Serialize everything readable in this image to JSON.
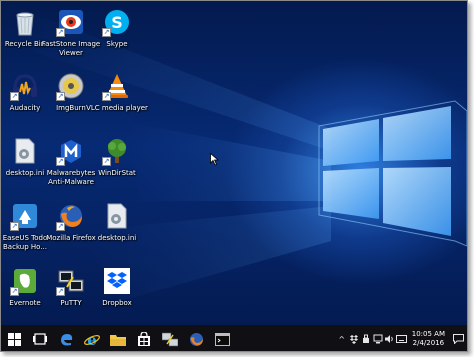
{
  "desktop": {
    "icons": [
      {
        "label": "Recycle Bin",
        "icon": "recycle-bin-icon"
      },
      {
        "label": "FastStone Image Viewer",
        "icon": "faststone-icon"
      },
      {
        "label": "Skype",
        "icon": "skype-icon"
      },
      {
        "label": "Audacity",
        "icon": "audacity-icon"
      },
      {
        "label": "ImgBurn",
        "icon": "imgburn-icon"
      },
      {
        "label": "VLC media player",
        "icon": "vlc-icon"
      },
      {
        "label": "desktop.ini",
        "icon": "ini-file-icon"
      },
      {
        "label": "Malwarebytes Anti-Malware",
        "icon": "malwarebytes-icon"
      },
      {
        "label": "WinDirStat",
        "icon": "windirstat-icon"
      },
      {
        "label": "EaseUS Todo Backup Ho...",
        "icon": "easeus-icon"
      },
      {
        "label": "Mozilla Firefox",
        "icon": "firefox-icon"
      },
      {
        "label": "desktop.ini",
        "icon": "ini-file-icon"
      },
      {
        "label": "Evernote",
        "icon": "evernote-icon"
      },
      {
        "label": "PuTTY",
        "icon": "putty-icon"
      },
      {
        "label": "Dropbox",
        "icon": "dropbox-icon"
      }
    ]
  },
  "taskbar": {
    "buttons": [
      {
        "icon": "start-icon"
      },
      {
        "icon": "task-view-icon"
      },
      {
        "icon": "edge-icon"
      },
      {
        "icon": "internet-explorer-icon"
      },
      {
        "icon": "file-explorer-icon"
      },
      {
        "icon": "store-icon"
      },
      {
        "icon": "putty-icon"
      },
      {
        "icon": "firefox-icon"
      },
      {
        "icon": "command-prompt-icon"
      }
    ],
    "tray": {
      "chevron": "^",
      "time": "10:05 AM",
      "date": "2/4/2016"
    }
  },
  "colors": {
    "desktop_dark": "#041b52",
    "desktop_glow": "#2f7fe0",
    "taskbar": "#101014",
    "active_indicator": "#7fb0f0"
  }
}
